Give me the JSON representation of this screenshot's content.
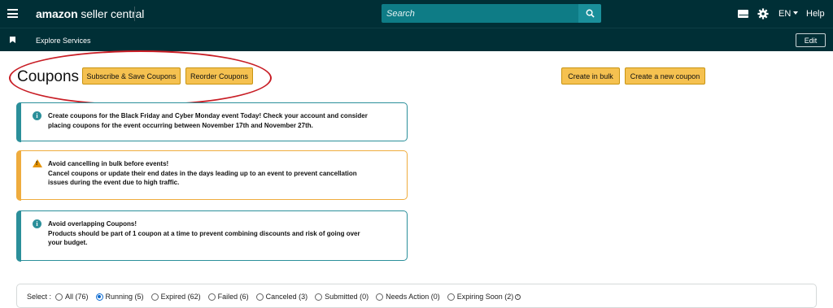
{
  "header": {
    "logo_bold": "amazon",
    "logo_rest": " seller central",
    "search_placeholder": "Search",
    "language": "EN",
    "help": "Help"
  },
  "subnav": {
    "explore": "Explore Services",
    "edit": "Edit"
  },
  "page": {
    "title": "Coupons",
    "buttons": {
      "subscribe_save": "Subscribe & Save Coupons",
      "reorder": "Reorder Coupons",
      "create_bulk": "Create in bulk",
      "create_new": "Create a new coupon"
    }
  },
  "alerts": [
    {
      "type": "info",
      "line1": "Create coupons for the Black Friday and Cyber Monday event Today! Check your account and consider",
      "line2": "placing coupons for the event occurring between November 17th and November 27th."
    },
    {
      "type": "warning",
      "line1": "Avoid cancelling in bulk before events!",
      "line2": "Cancel coupons or update their end dates in the days leading up to an event to prevent cancellation",
      "line3": "issues during the event due to high traffic."
    },
    {
      "type": "info",
      "line1": "Avoid overlapping Coupons!",
      "line2": "Products should be part of 1 coupon at a time to prevent combining discounts and risk of going over",
      "line3": "your budget."
    }
  ],
  "filter": {
    "label": "Select :",
    "options": [
      {
        "label": "All (76)",
        "checked": false
      },
      {
        "label": "Running (5)",
        "checked": true
      },
      {
        "label": "Expired (62)",
        "checked": false
      },
      {
        "label": "Failed (6)",
        "checked": false
      },
      {
        "label": "Canceled (3)",
        "checked": false
      },
      {
        "label": "Submitted (0)",
        "checked": false
      },
      {
        "label": "Needs Action (0)",
        "checked": false
      },
      {
        "label": "Expiring Soon (2)",
        "checked": false
      }
    ]
  },
  "colors": {
    "header_bg": "#002f36",
    "search_bg": "#0e7c86",
    "button_yellow": "#f5c150",
    "info_teal": "#2b8f9a",
    "warning_orange": "#efac3e",
    "annotation_red": "#c81d25"
  }
}
